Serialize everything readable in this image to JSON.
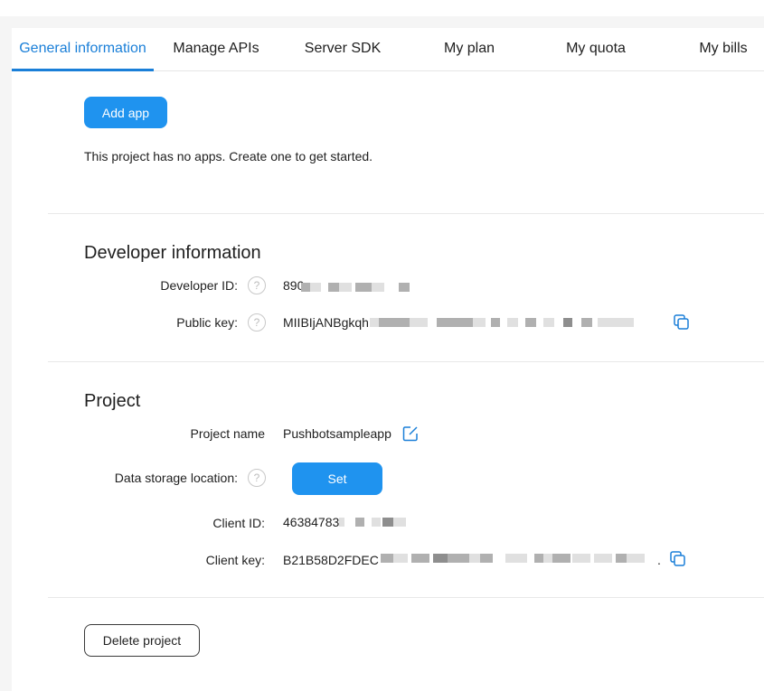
{
  "tabs": [
    {
      "label": "General information",
      "active": true
    },
    {
      "label": "Manage APIs",
      "active": false
    },
    {
      "label": "Server SDK",
      "active": false
    },
    {
      "label": "My plan",
      "active": false
    },
    {
      "label": "My quota",
      "active": false
    },
    {
      "label": "My bills",
      "active": false
    }
  ],
  "apps": {
    "add_button": "Add app",
    "empty_message": "This project has no apps. Create one to get started."
  },
  "developer": {
    "title": "Developer information",
    "id_label": "Developer ID:",
    "id_value": "890",
    "public_key_label": "Public key:",
    "public_key_value": "MIIBIjANBgkqh"
  },
  "project": {
    "title": "Project",
    "name_label": "Project name",
    "name_value": "Pushbotsampleapp",
    "storage_label": "Data storage location:",
    "storage_button": "Set",
    "client_id_label": "Client ID:",
    "client_id_value": "46384783",
    "client_key_label": "Client key:",
    "client_key_value": "B21B58D2FDEC",
    "client_key_trailing": ".",
    "delete_button": "Delete project"
  },
  "colors": {
    "accent": "#1a7fd8",
    "primary_button": "#1f93ef",
    "background": "#f5f5f5"
  }
}
